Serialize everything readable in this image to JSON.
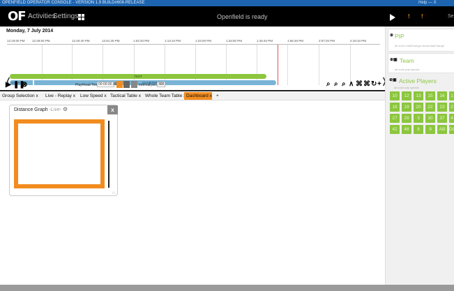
{
  "window": {
    "title": "OPENFIELD OPERATOR CONSOLE - VERSION 1.9 BUILD#608-RELEASE",
    "controls_text": "Help  —  X"
  },
  "appbar": {
    "logo": "OF",
    "menu": [
      "Activities",
      "Settings"
    ],
    "status": "Openfield is ready",
    "markers": [
      "!",
      "!"
    ],
    "trunc": "Se"
  },
  "timeline": {
    "date": "Monday, 7 July 2014",
    "ticks": [
      "12:19:00 PM",
      "12:29:50 PM",
      "12:40:40 PM",
      "12:51:30 PM",
      "1:02:20 PM",
      "1:13:10 PM",
      "1:24:00 PM",
      "1:34:50 PM",
      "1:45:40 PM",
      "1:56:30 PM",
      "2:07:20 PM",
      "2:18:10 PM"
    ],
    "session_label": "TEST",
    "quarter_label": "QUARTER",
    "quarter2_label": "QUARTER (2)"
  },
  "controls": {
    "playhead_label": "PlayHead Time:",
    "playhead_value": "00:00:00.000",
    "interval_label": "Interval(sec):",
    "interval_value": "300"
  },
  "tabs": [
    {
      "label": "Group Selection",
      "close": "x"
    },
    {
      "label": "Live - Replay",
      "close": "x"
    },
    {
      "label": "Low Speed",
      "close": "x"
    },
    {
      "label": "Tactical Table",
      "close": "x"
    },
    {
      "label": "Whole Team Table",
      "close": "x"
    },
    {
      "label": "Dashboard",
      "close": "x"
    },
    {
      "label": "+",
      "close": ""
    }
  ],
  "panel": {
    "title": "Distance Graph",
    "live": "-Live-",
    "close": "x"
  },
  "right": {
    "pip": {
      "title": "PIP",
      "sub": "all  none  InItalChange  showInItalChange"
    },
    "team": {
      "title": "Team",
      "sub": "all  none  pdp  special"
    },
    "players": {
      "title": "Active Players",
      "sub": "all  none  pdp  special",
      "badges": [
        "10",
        "12",
        "13",
        "15",
        "16",
        "1",
        "18",
        "19",
        "20",
        "22",
        "23",
        "2",
        "27",
        "28",
        "3",
        "30",
        "37",
        "4",
        "42",
        "48",
        "8",
        "9",
        "AB",
        "DO"
      ]
    }
  },
  "colors": {
    "accent": "#f28c1f",
    "green": "#8cc63e",
    "blue": "#79b4d6",
    "titlebar": "#1c64b0"
  }
}
